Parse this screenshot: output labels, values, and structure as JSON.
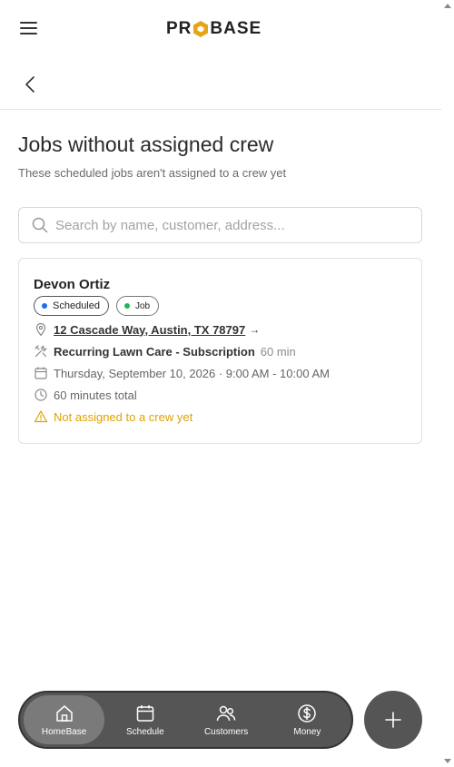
{
  "header": {
    "logo_text": {
      "left": "PR",
      "right": "BASE"
    },
    "logo_accent": "#e8a317"
  },
  "page": {
    "title": "Jobs without assigned crew",
    "subtitle": "These scheduled jobs aren't assigned to a crew yet"
  },
  "search": {
    "placeholder": "Search by name, customer, address...",
    "value": ""
  },
  "jobs": [
    {
      "customer": "Devon Ortiz",
      "status": {
        "label": "Scheduled",
        "dot_color": "#1a6fe8"
      },
      "type": {
        "label": "Job",
        "dot_color": "#22b35e"
      },
      "address": "12 Cascade Way, Austin, TX 78797",
      "address_arrow": "→",
      "service": "Recurring Lawn Care - Subscription",
      "service_duration": "60 min",
      "date": "Thursday, September 10, 2026 · 9:00 AM - 10:00 AM",
      "total": "60 minutes total",
      "warning": "Not assigned to a crew yet",
      "warning_color": "#e0a100"
    }
  ],
  "bottom_nav": {
    "items": [
      {
        "label": "HomeBase",
        "icon": "home-icon",
        "active": true
      },
      {
        "label": "Schedule",
        "icon": "calendar-icon",
        "active": false
      },
      {
        "label": "Customers",
        "icon": "users-icon",
        "active": false
      },
      {
        "label": "Money",
        "icon": "dollar-icon",
        "active": false
      }
    ],
    "fab_icon": "plus-icon"
  }
}
